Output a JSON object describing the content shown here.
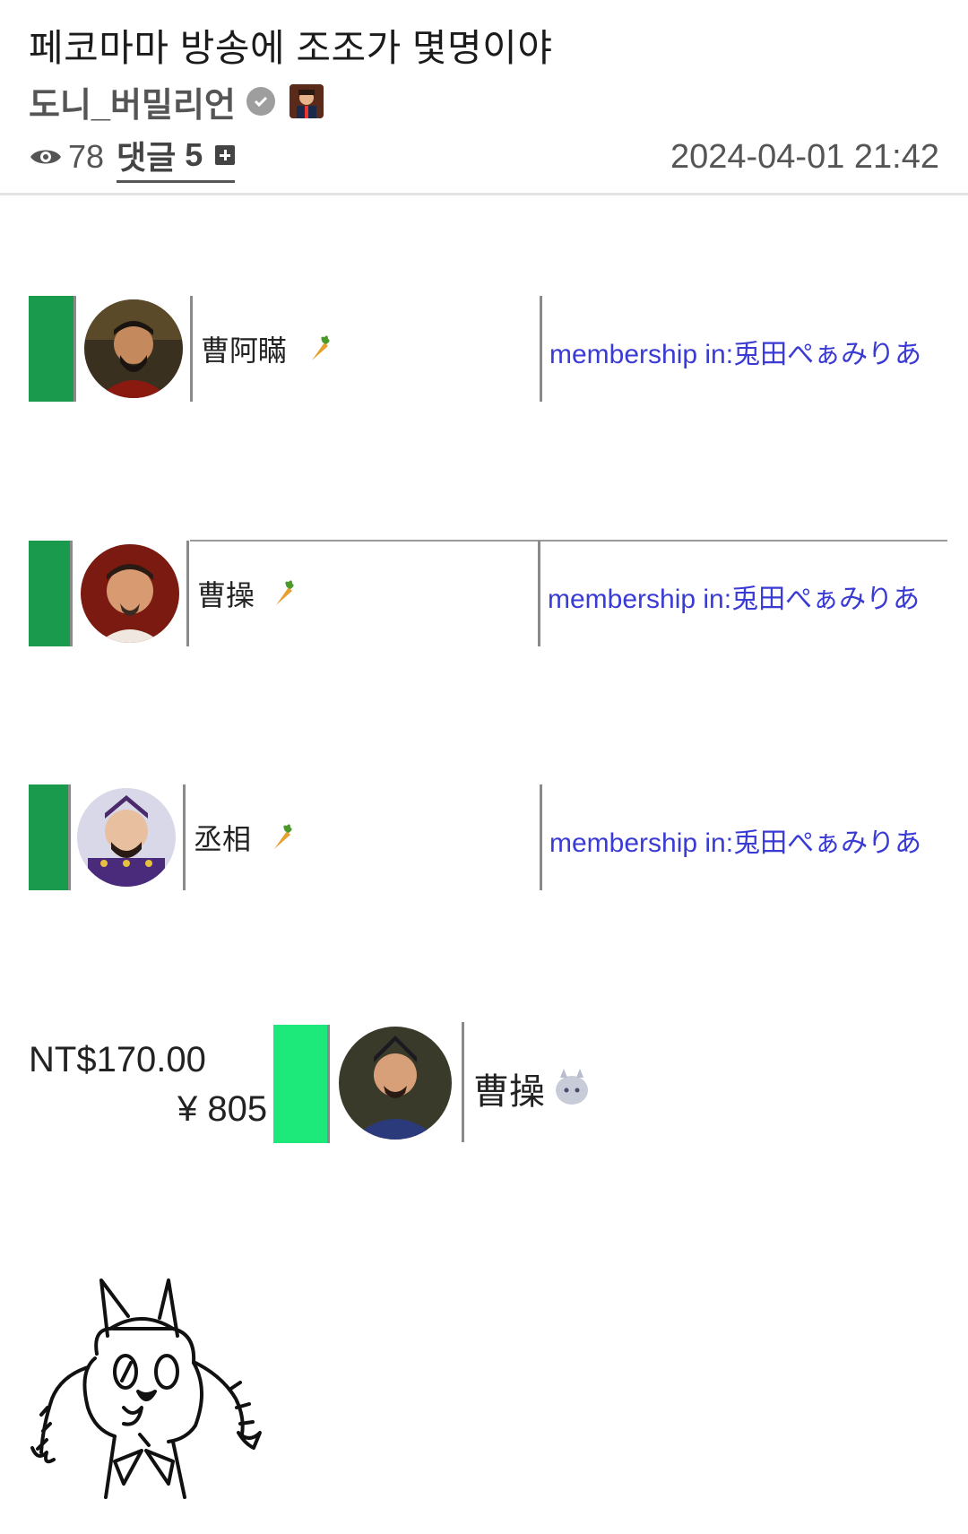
{
  "post": {
    "title": "페코마마 방송에 조조가 몇명이야",
    "author": "도니_버밀리언",
    "views": "78",
    "comments_label": "댓글",
    "comments_count": "5",
    "timestamp": "2024-04-01 21:42"
  },
  "chat_rows": [
    {
      "name": "曹阿瞞",
      "membership": "membership in:兎田ぺぁみりあ"
    },
    {
      "name": "曹操",
      "membership": "membership in:兎田ぺぁみりあ"
    },
    {
      "name": "丞相",
      "membership": "membership in:兎田ぺぁみりあ"
    }
  ],
  "superchat": {
    "amount": "NT$170.00",
    "converted": "¥ 805",
    "name": "曹操"
  },
  "icons": [
    "eye-icon",
    "verified-check-icon",
    "comment-add-icon",
    "carrot-icon",
    "member-badge-icon"
  ],
  "colors": {
    "chat_bar": "#1a9a4c",
    "superchat_bar": "#1de87a",
    "membership_text": "#3a3ad4"
  }
}
